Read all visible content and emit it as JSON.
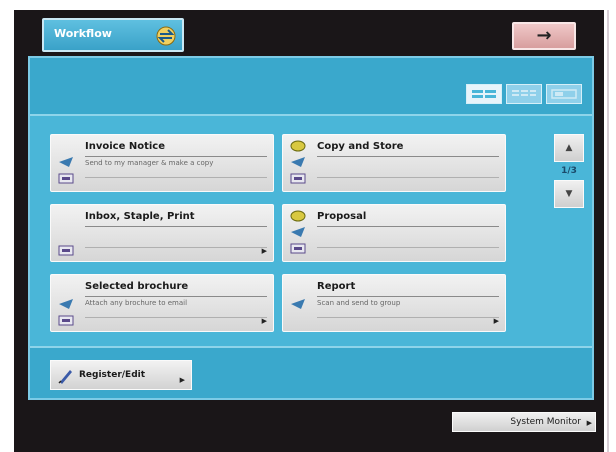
{
  "header": {
    "workflow_tab_label": "Workflow",
    "next_arrow": "→"
  },
  "view_toggle": {
    "options": [
      "list-view",
      "compact-view",
      "large-view"
    ],
    "active": "list-view"
  },
  "workflows": [
    {
      "title": "Invoice Notice",
      "description": "Send to my manager & make a copy",
      "icons": [
        "send-icon",
        "print-icon"
      ],
      "has_arrow": false
    },
    {
      "title": "Copy and Store",
      "description": "",
      "icons": [
        "store-icon",
        "send-icon",
        "print-icon"
      ],
      "has_arrow": false
    },
    {
      "title": "Inbox, Staple, Print",
      "description": "",
      "icons": [
        "print-icon"
      ],
      "has_arrow": true
    },
    {
      "title": "Proposal",
      "description": "",
      "icons": [
        "store-icon",
        "send-icon",
        "print-icon"
      ],
      "has_arrow": false
    },
    {
      "title": "Selected brochure",
      "description": "Attach any brochure to email",
      "icons": [
        "send-icon",
        "print-icon"
      ],
      "has_arrow": true
    },
    {
      "title": "Report",
      "description": "Scan and send to group",
      "icons": [
        "send-icon"
      ],
      "has_arrow": true
    }
  ],
  "pagination": {
    "page": "1/3"
  },
  "footer": {
    "register_label": "Register/Edit",
    "system_monitor_label": "System Monitor"
  },
  "colors": {
    "panel": "#4ab6d8",
    "panel_band": "#3aa8cc",
    "background": "#1a1618",
    "button": "#e0e0e0",
    "arrow_button": "#e0b0b0"
  }
}
